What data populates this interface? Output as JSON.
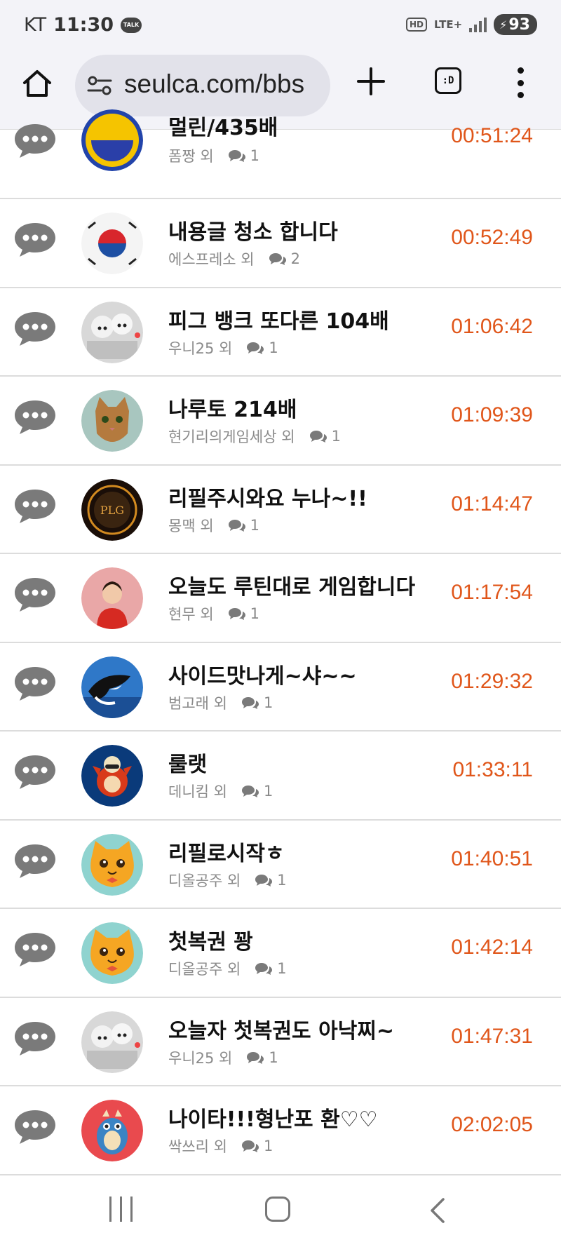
{
  "status_bar": {
    "carrier": "KT",
    "time": "11:30",
    "talk_label": "TALK",
    "hd_label": "HD",
    "network": "LTE+",
    "battery": "93"
  },
  "browser": {
    "url": "seulca.com/bbs",
    "tabs_label": ":D"
  },
  "posts": [
    {
      "title": "멀린/435배",
      "author": "폼짱 외",
      "comments": "1",
      "time": "00:51:24",
      "avatar": "yellow-blue-face"
    },
    {
      "title": "내용글 청소 합니다",
      "author": "에스프레소 외",
      "comments": "2",
      "time": "00:52:49",
      "avatar": "korean-flag"
    },
    {
      "title": "피그 뱅크 또다른 104배",
      "author": "우니25 외",
      "comments": "1",
      "time": "01:06:42",
      "avatar": "white-dogs"
    },
    {
      "title": "나루토 214배",
      "author": "현기리의게임세상 외",
      "comments": "1",
      "time": "01:09:39",
      "avatar": "cat"
    },
    {
      "title": "리필주시와요 누나~!!",
      "author": "몽맥 외",
      "comments": "1",
      "time": "01:14:47",
      "avatar": "dark-badge"
    },
    {
      "title": "오늘도 루틴대로 게임합니다",
      "author": "현무 외",
      "comments": "1",
      "time": "01:17:54",
      "avatar": "woman-red"
    },
    {
      "title": "사이드맛나게~샤~~",
      "author": "범고래 외",
      "comments": "1",
      "time": "01:29:32",
      "avatar": "orca"
    },
    {
      "title": "룰랫",
      "author": "데니킴 외",
      "comments": "1",
      "time": "01:33:11",
      "avatar": "cartoon-bird"
    },
    {
      "title": "리필로시작ㅎ",
      "author": "디올공주 외",
      "comments": "1",
      "time": "01:40:51",
      "avatar": "yellow-cat"
    },
    {
      "title": "첫복권 꽝",
      "author": "디올공주 외",
      "comments": "1",
      "time": "01:42:14",
      "avatar": "yellow-cat"
    },
    {
      "title": "오늘자 첫복권도 아낙찌~",
      "author": "우니25 외",
      "comments": "1",
      "time": "01:47:31",
      "avatar": "white-dogs"
    },
    {
      "title": "나이타!!!형난포 환♡♡",
      "author": "싹쓰리 외",
      "comments": "1",
      "time": "02:02:05",
      "avatar": "blue-dragon"
    }
  ],
  "colors": {
    "time": "#e0561a",
    "meta": "#8a8a8a",
    "icon": "#7a7a7a"
  }
}
